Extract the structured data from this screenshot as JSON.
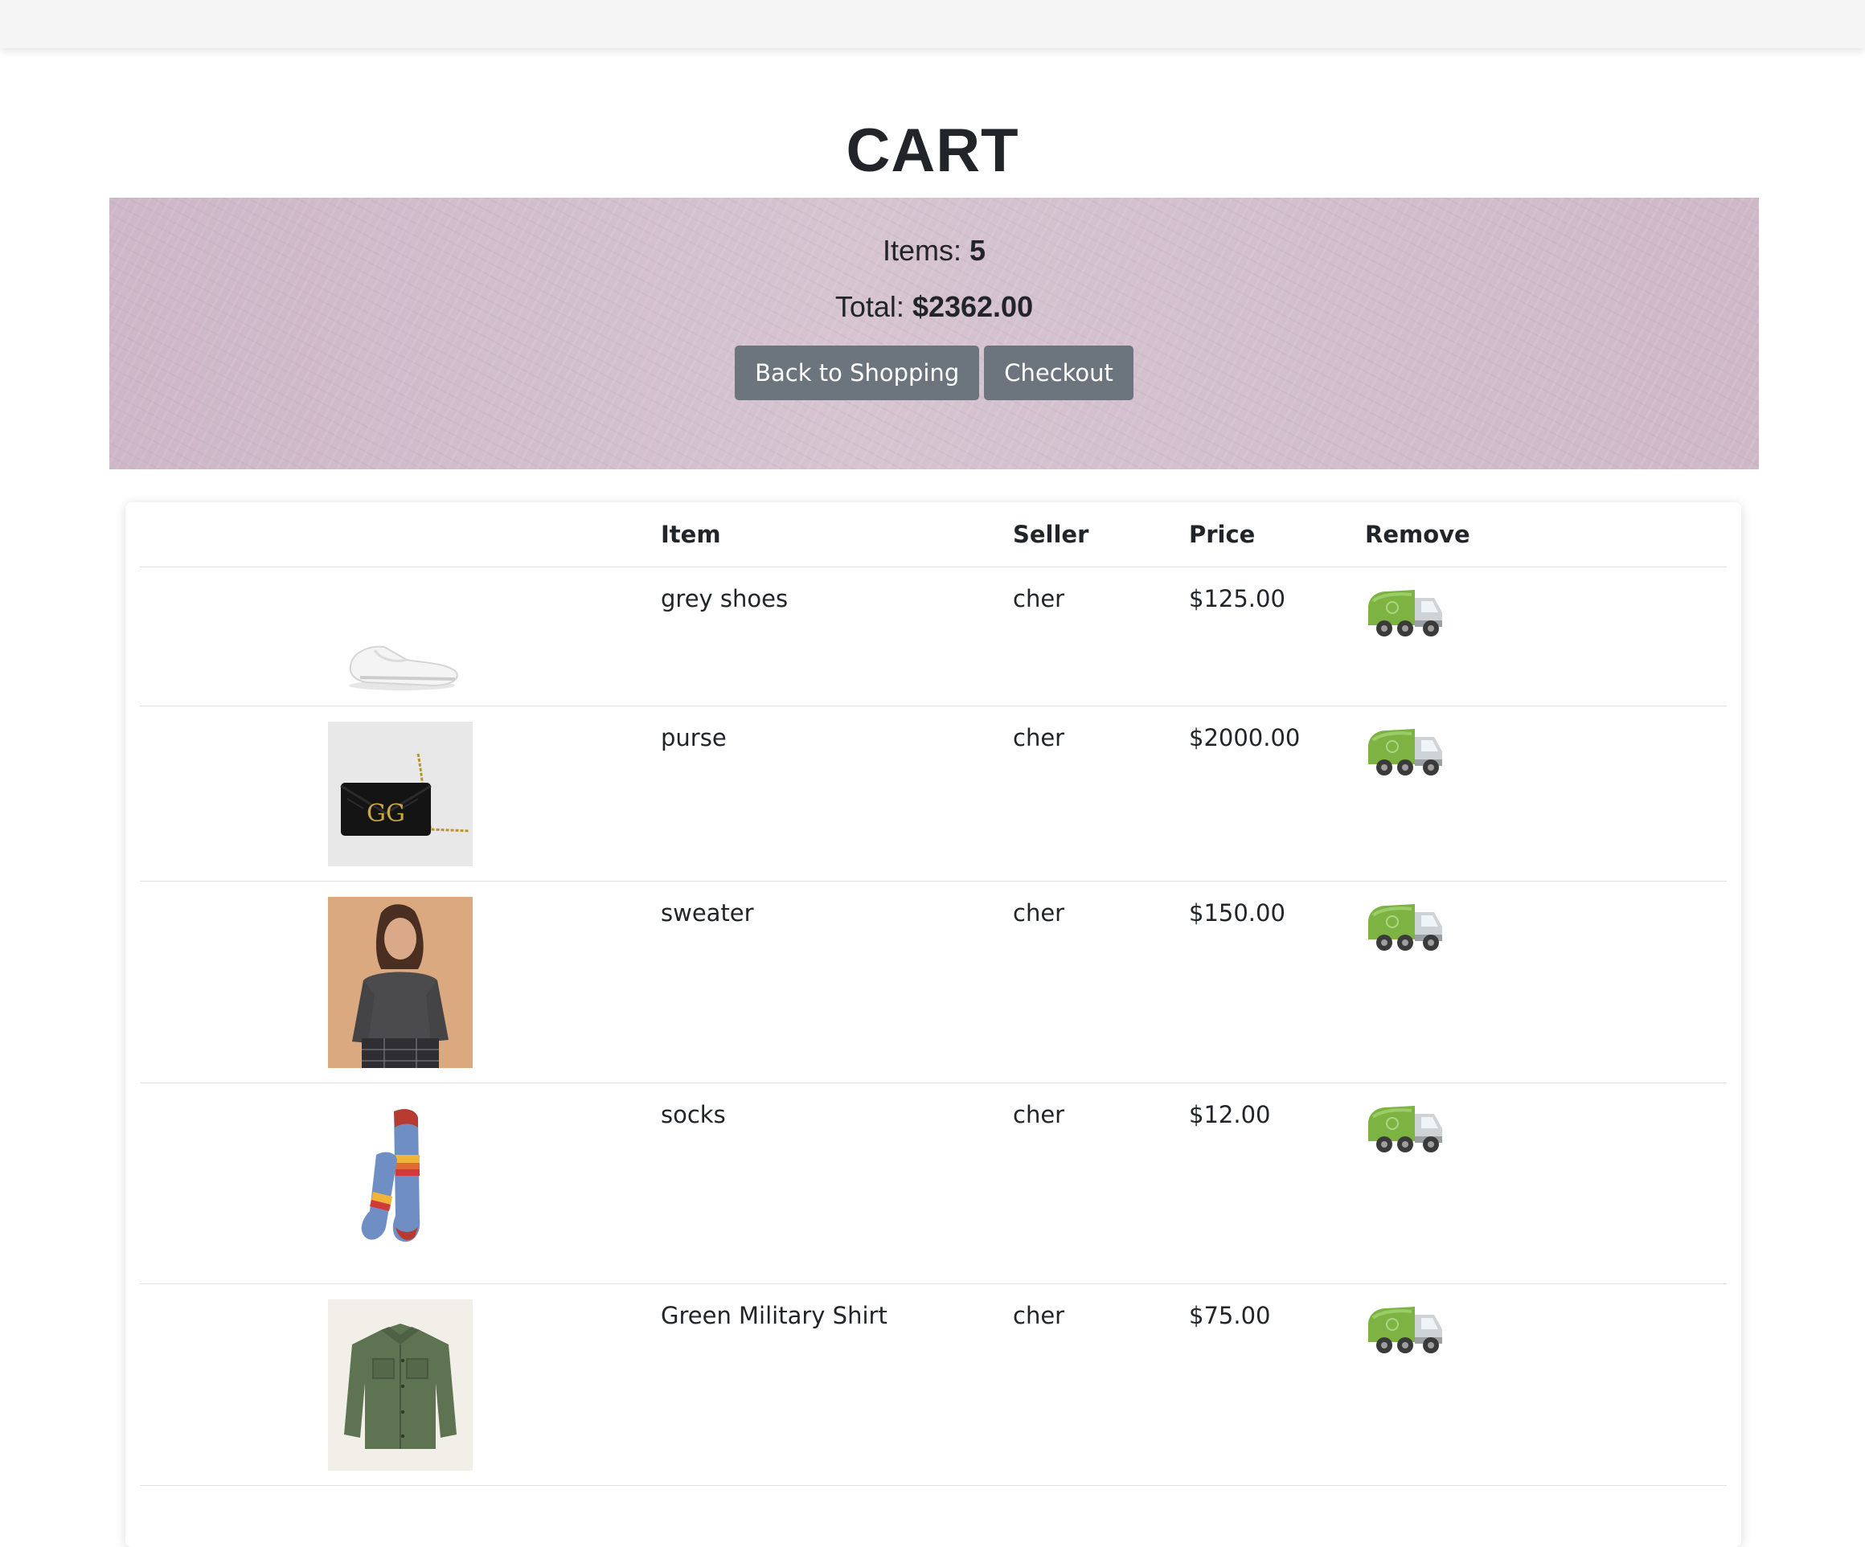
{
  "page": {
    "title": "CART"
  },
  "summary": {
    "items_label": "Items: ",
    "items_count": "5",
    "total_label": "Total: ",
    "total_value": "$2362.00",
    "back_button": "Back to Shopping",
    "checkout_button": "Checkout"
  },
  "table": {
    "headers": {
      "image": "",
      "item": "Item",
      "seller": "Seller",
      "price": "Price",
      "remove": "Remove"
    },
    "rows": [
      {
        "item": "grey shoes",
        "seller": "cher",
        "price": "$125.00",
        "image_icon": "white-slip-on-shoe",
        "remove_icon": "garbage-truck-icon"
      },
      {
        "item": "purse",
        "seller": "cher",
        "price": "$2000.00",
        "image_icon": "black-chain-purse",
        "remove_icon": "garbage-truck-icon"
      },
      {
        "item": "sweater",
        "seller": "cher",
        "price": "$150.00",
        "image_icon": "grey-sweater-model",
        "remove_icon": "garbage-truck-icon"
      },
      {
        "item": "socks",
        "seller": "cher",
        "price": "$12.00",
        "image_icon": "striped-socks",
        "remove_icon": "garbage-truck-icon"
      },
      {
        "item": "Green Military Shirt",
        "seller": "cher",
        "price": "$75.00",
        "image_icon": "green-military-shirt",
        "remove_icon": "garbage-truck-icon"
      }
    ]
  },
  "colors": {
    "banner": "#d2bfcd",
    "button": "#6c757d",
    "text": "#212529",
    "truck_green": "#7cb342"
  }
}
